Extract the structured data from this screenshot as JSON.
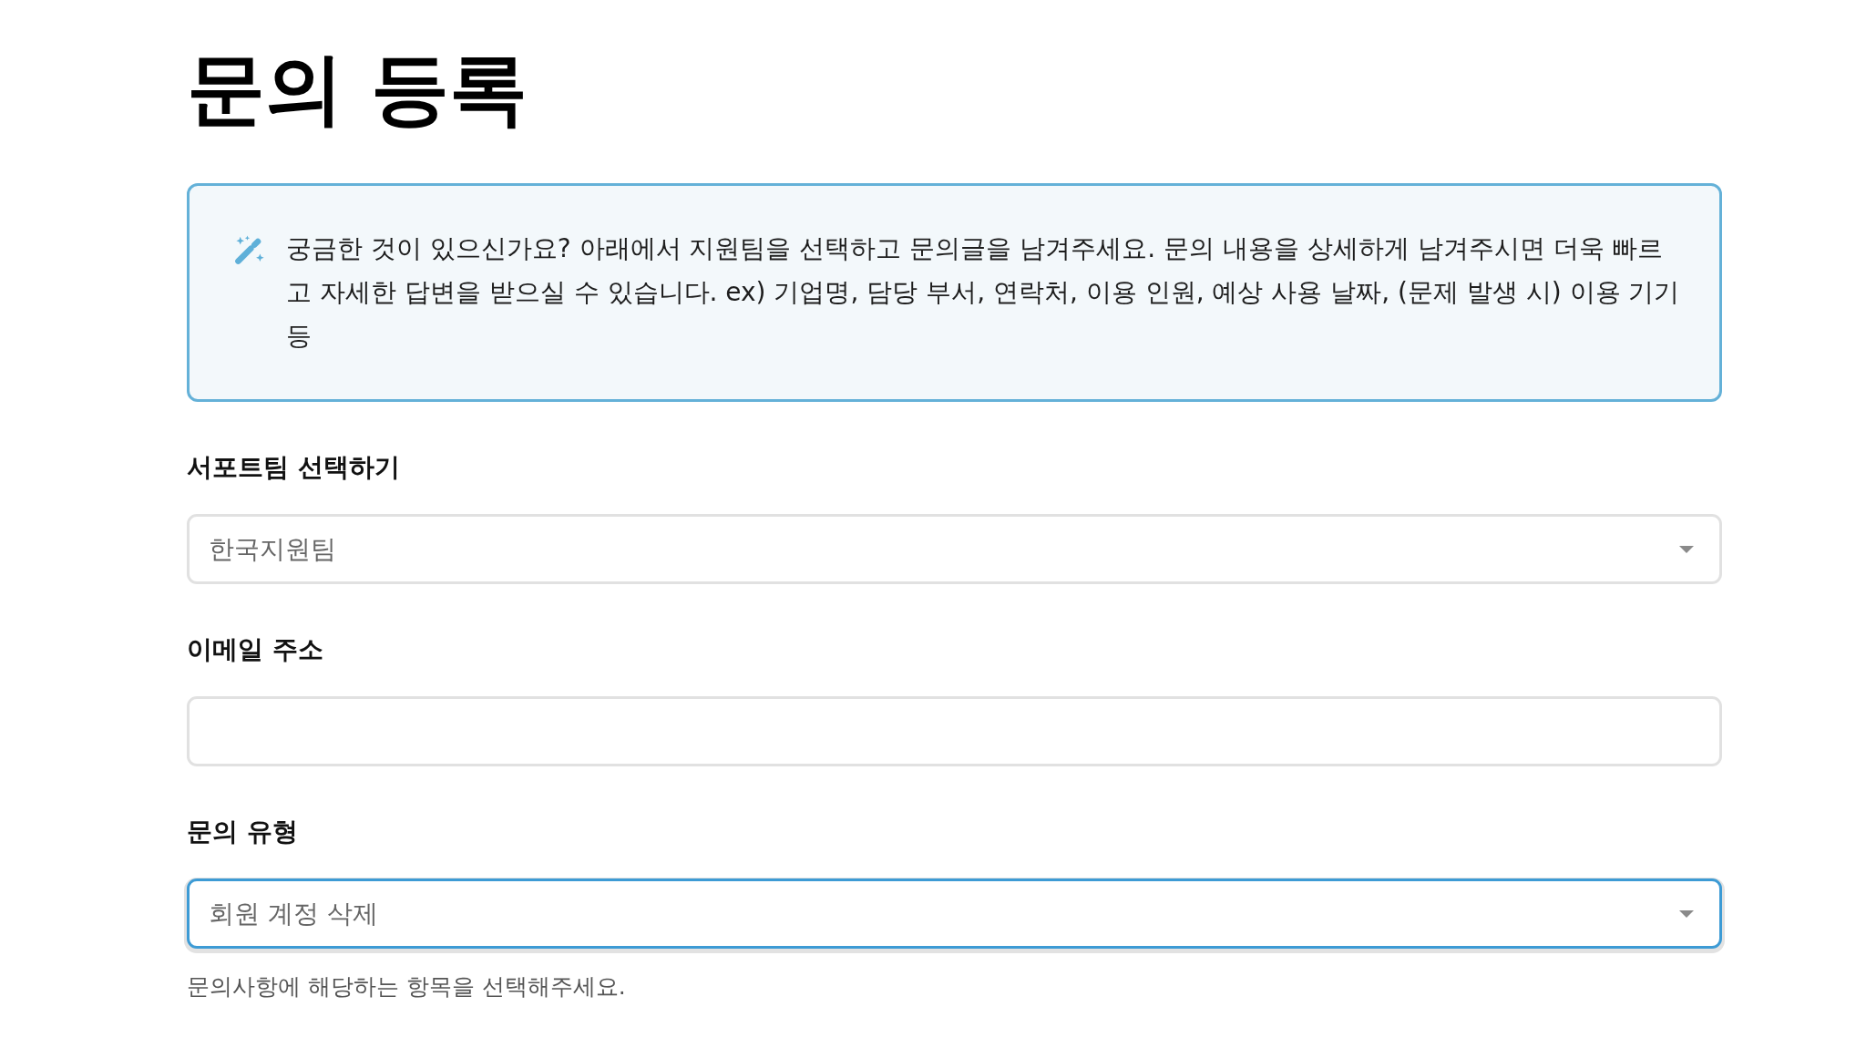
{
  "page": {
    "title": "문의 등록"
  },
  "notice": {
    "text": "궁금한 것이 있으신가요? 아래에서 지원팀을 선택하고 문의글을 남겨주세요. 문의 내용을 상세하게 남겨주시면 더욱 빠르고 자세한 답변을 받으실 수 있습니다. ex) 기업명, 담당 부서, 연락처, 이용 인원, 예상 사용 날짜, (문제 발생 시) 이용 기기 등"
  },
  "fields": [
    {
      "kind": "select",
      "label": "서포트팀 선택하기",
      "value": "한국지원팀",
      "focused": false
    },
    {
      "kind": "input",
      "label": "이메일 주소",
      "focused": false
    },
    {
      "kind": "select",
      "label": "문의 유형",
      "value": "회원 계정 삭제",
      "focused": true,
      "help": "문의사항에 해당하는 항목을 선택해주세요."
    }
  ]
}
